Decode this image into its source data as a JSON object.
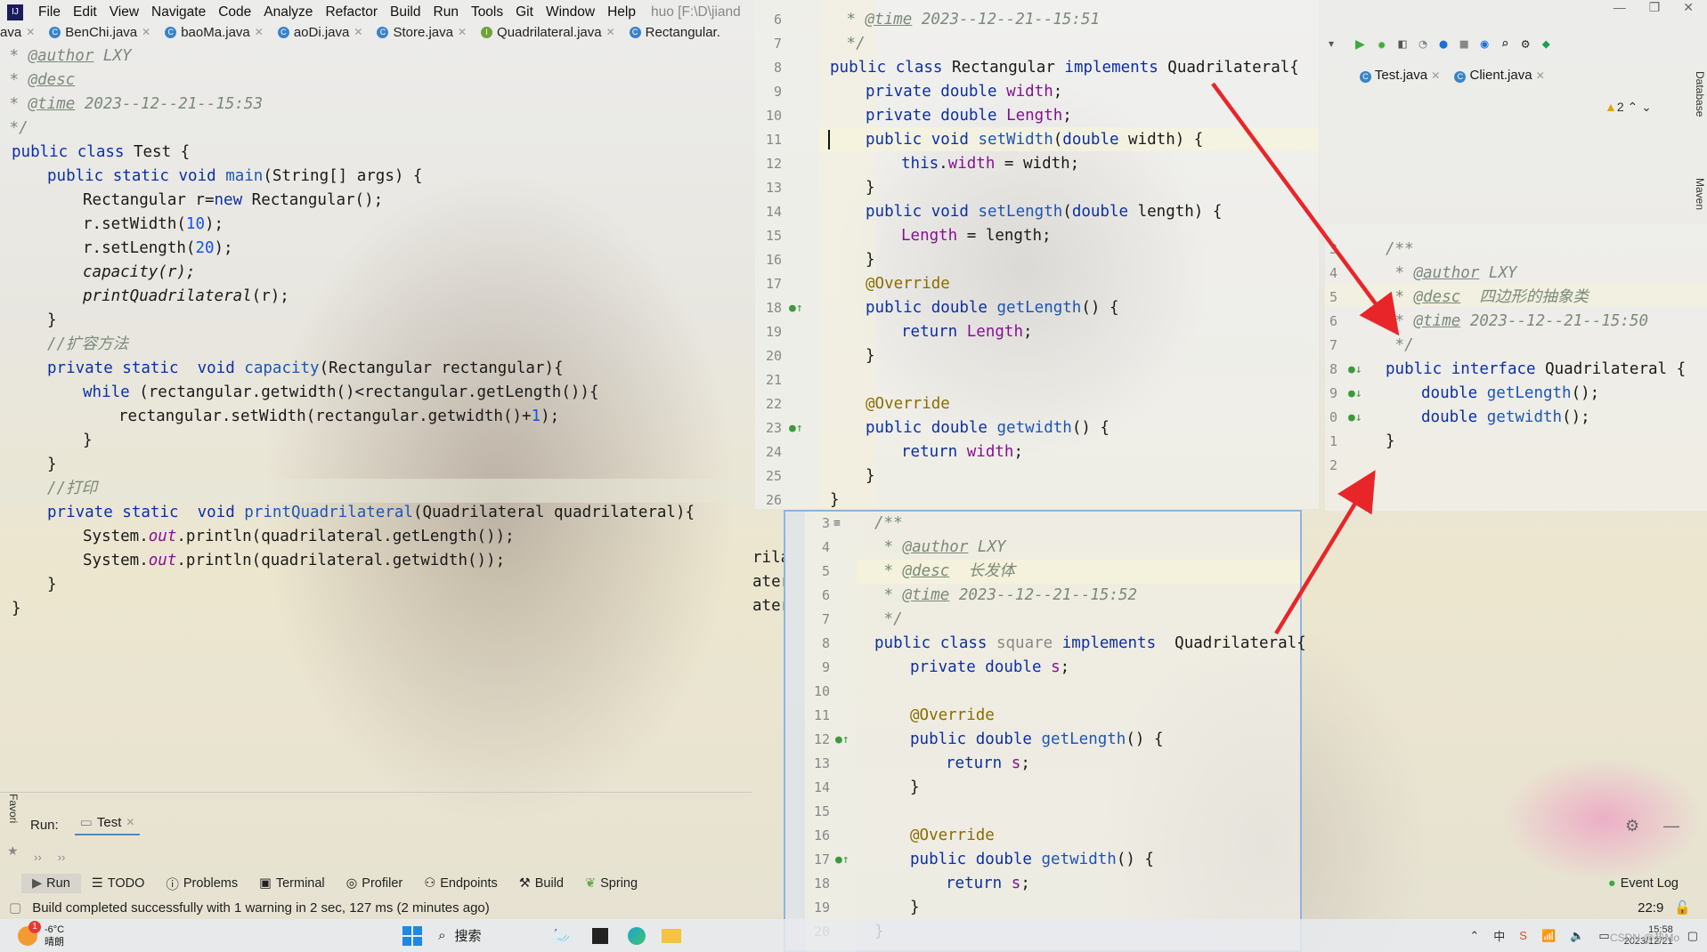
{
  "menubar": {
    "items": [
      "File",
      "Edit",
      "View",
      "Navigate",
      "Code",
      "Analyze",
      "Refactor",
      "Build",
      "Run",
      "Tools",
      "Git",
      "Window",
      "Help"
    ],
    "project": "huo [F:\\D\\jiand"
  },
  "tabs": [
    {
      "label": "ava",
      "icon": ""
    },
    {
      "label": "BenChi.java",
      "icon": "class-icon"
    },
    {
      "label": "baoMa.java",
      "icon": "class-icon"
    },
    {
      "label": "aoDi.java",
      "icon": "class-icon"
    },
    {
      "label": "Store.java",
      "icon": "class-icon"
    },
    {
      "label": "Quadrilateral.java",
      "icon": "interface-icon"
    },
    {
      "label": "Rectangular.",
      "icon": "class-icon"
    }
  ],
  "test_code": {
    "author_tag": "@author",
    "author": " LXY",
    "desc_tag": "@desc",
    "time_tag": "@time",
    "time": " 2023--12--21--15:53",
    "close": " */",
    "comment_expand": "//扩容方法",
    "comment_print": "//打印"
  },
  "rect_code": {
    "time_tag": "@time",
    "time": " 2023--12--21--15:51",
    "lines": [
      "6",
      "7",
      "8",
      "9",
      "10",
      "11",
      "12",
      "13",
      "14",
      "15",
      "16",
      "17",
      "18",
      "19",
      "20",
      "21",
      "22",
      "23",
      "24",
      "25",
      "26"
    ]
  },
  "quad_code": {
    "author": " LXY",
    "desc": "  四边形的抽象类",
    "time": " 2023--12--21--15:50",
    "lines": [
      "3",
      "4",
      "5",
      "6",
      "7",
      "8",
      "9",
      "0",
      "1",
      "2"
    ]
  },
  "square_code": {
    "author": " LXY",
    "desc": "  长发体",
    "time": " 2023--12--21--15:52",
    "lines": [
      "3",
      "4",
      "5",
      "6",
      "7",
      "8",
      "9",
      "10",
      "11",
      "12",
      "13",
      "14",
      "15",
      "16",
      "17",
      "18",
      "19",
      "20"
    ]
  },
  "partial_lines": [
    "rila",
    "ater",
    "ater"
  ],
  "right_panel": {
    "tabs": [
      "Test.java",
      "Client.java"
    ],
    "warnings": "2",
    "sidebar": [
      "Database",
      "Maven"
    ]
  },
  "run": {
    "label": "Run:",
    "config": "Test",
    "favorites": "Favori"
  },
  "toolwindows": [
    "Run",
    "TODO",
    "Problems",
    "Terminal",
    "Profiler",
    "Endpoints",
    "Build",
    "Spring"
  ],
  "event_log": "Event Log",
  "status": {
    "message": "Build completed successfully with 1 warning in 2 sec, 127 ms (2 minutes ago)",
    "position": "22:9"
  },
  "taskbar": {
    "weather_temp": "-6°C",
    "weather_text": "晴朗",
    "weather_badge": "1",
    "search": "搜索",
    "time": "15:58",
    "date": "2023/12/21",
    "watermark": "CSDN @热Mo"
  }
}
